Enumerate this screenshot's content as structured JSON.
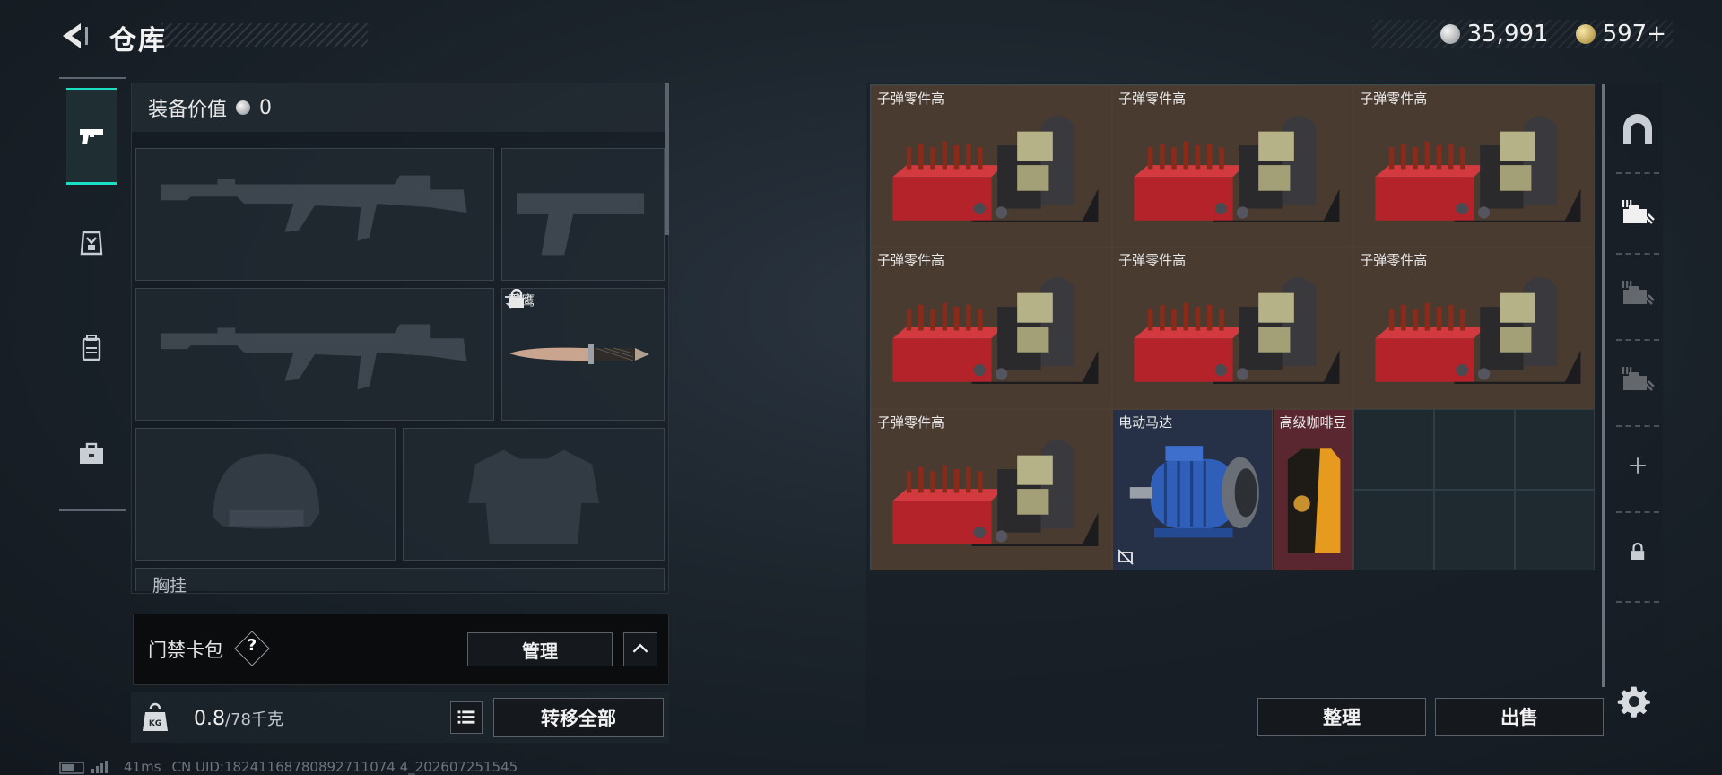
{
  "header": {
    "title": "仓库",
    "back_icon": "back-arrow-icon",
    "currencies": [
      {
        "icon": "silver-coin-icon",
        "value": "35,991"
      },
      {
        "icon": "gold-coin-icon",
        "value": "597+"
      }
    ]
  },
  "left_tabs": [
    {
      "name": "weapons",
      "icon": "pistol-icon",
      "active": true
    },
    {
      "name": "gear",
      "icon": "armor-bag-icon",
      "active": false
    },
    {
      "name": "backpack",
      "icon": "backpack-icon",
      "active": false
    },
    {
      "name": "toolbox",
      "icon": "briefcase-icon",
      "active": false
    }
  ],
  "equipment": {
    "label": "装备价值",
    "value": "0",
    "knife": {
      "name": "黑鹰",
      "locked": true
    },
    "chest_label": "胸挂",
    "chest_hint": "?"
  },
  "keycard": {
    "label": "门禁卡包",
    "help": "?",
    "manage_label": "管理"
  },
  "weight": {
    "value": "0.8",
    "capacity": "/78千克",
    "transfer_label": "转移全部"
  },
  "status": {
    "ping": "41ms",
    "uid": "CN UID:18241168780892711074 4_202607251545"
  },
  "storage": {
    "items": [
      {
        "name": "子弹零件高",
        "type": "ammo"
      },
      {
        "name": "子弹零件高",
        "type": "ammo"
      },
      {
        "name": "子弹零件高",
        "type": "ammo"
      },
      {
        "name": "子弹零件高",
        "type": "ammo"
      },
      {
        "name": "子弹零件高",
        "type": "ammo"
      },
      {
        "name": "子弹零件高",
        "type": "ammo"
      },
      {
        "name": "子弹零件高",
        "type": "ammo"
      },
      {
        "name": "电动马达",
        "type": "motor"
      },
      {
        "name": "高级咖啡豆",
        "type": "coffee"
      }
    ],
    "sort_label": "整理",
    "sell_label": "出售"
  },
  "right_rail": [
    {
      "icon": "arch-icon"
    },
    {
      "icon": "storage-tier-3-icon"
    },
    {
      "icon": "storage-tier-3-icon-dim"
    },
    {
      "icon": "storage-tier-3-icon-dim"
    },
    {
      "icon": "plus-icon"
    },
    {
      "icon": "lock-icon"
    }
  ],
  "colors": {
    "accent": "#19e0c2",
    "ammo_bg": "#4a3b31",
    "motor_bg": "#263046",
    "coffee_bg": "#5a2630"
  }
}
